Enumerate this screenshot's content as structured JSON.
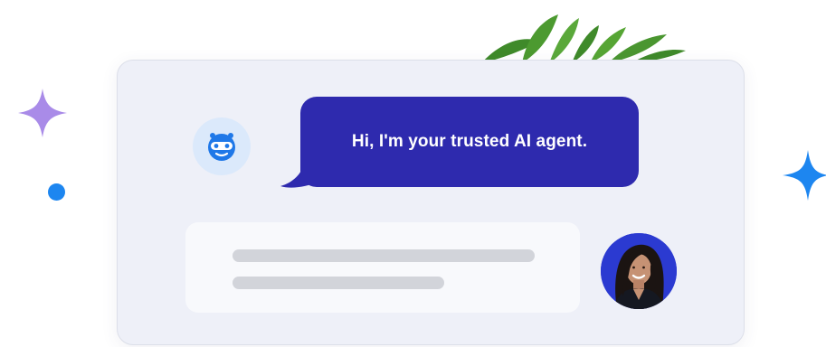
{
  "chat": {
    "agent_message": "Hi, I'm your trusted AI agent."
  },
  "colors": {
    "card_background": "#eef0f8",
    "agent_bubble": "#2e2aae",
    "agent_avatar_bg": "#dbe9fb",
    "agent_icon": "#1f78e8",
    "sparkle_purple": "#a98be8",
    "sparkle_blue": "#1d86f0",
    "dot_blue": "#1d86f0",
    "plant_green": "#3f8a2a",
    "skeleton_line": "#d2d4da",
    "user_avatar_bg": "#2b3ad1"
  },
  "icons": {
    "agent": "robot-face-icon",
    "sparkle_left": "sparkle-icon",
    "sparkle_right": "sparkle-icon",
    "plant": "plant-icon"
  }
}
